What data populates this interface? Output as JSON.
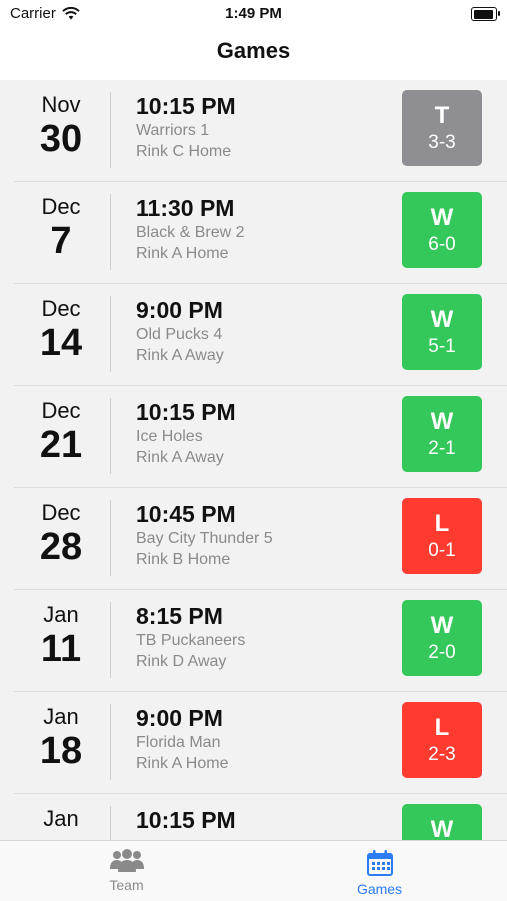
{
  "status": {
    "carrier": "Carrier",
    "time": "1:49 PM"
  },
  "nav": {
    "title": "Games"
  },
  "colors": {
    "tie": "#8e8e93",
    "win": "#34c759",
    "loss": "#ff3b30",
    "accent": "#2b7cf6"
  },
  "games": [
    {
      "month": "Nov",
      "day": "30",
      "time": "10:15 PM",
      "opponent": "Warriors 1",
      "rink": "Rink C Home",
      "result": "T",
      "score": "3-3",
      "status": "tie"
    },
    {
      "month": "Dec",
      "day": "7",
      "time": "11:30 PM",
      "opponent": "Black & Brew 2",
      "rink": "Rink A Home",
      "result": "W",
      "score": "6-0",
      "status": "win"
    },
    {
      "month": "Dec",
      "day": "14",
      "time": "9:00 PM",
      "opponent": "Old Pucks 4",
      "rink": "Rink A Away",
      "result": "W",
      "score": "5-1",
      "status": "win"
    },
    {
      "month": "Dec",
      "day": "21",
      "time": "10:15 PM",
      "opponent": "Ice Holes",
      "rink": "Rink A Away",
      "result": "W",
      "score": "2-1",
      "status": "win"
    },
    {
      "month": "Dec",
      "day": "28",
      "time": "10:45 PM",
      "opponent": "Bay City Thunder 5",
      "rink": "Rink B Home",
      "result": "L",
      "score": "0-1",
      "status": "loss"
    },
    {
      "month": "Jan",
      "day": "11",
      "time": "8:15 PM",
      "opponent": "TB Puckaneers",
      "rink": "Rink D Away",
      "result": "W",
      "score": "2-0",
      "status": "win"
    },
    {
      "month": "Jan",
      "day": "18",
      "time": "9:00 PM",
      "opponent": "Florida Man",
      "rink": "Rink A Home",
      "result": "L",
      "score": "2-3",
      "status": "loss"
    },
    {
      "month": "Jan",
      "day": "",
      "time": "10:15 PM",
      "opponent": "",
      "rink": "",
      "result": "W",
      "score": "",
      "status": "win"
    }
  ],
  "tabs": [
    {
      "label": "Team",
      "icon": "team-icon"
    },
    {
      "label": "Games",
      "icon": "calendar-icon"
    }
  ]
}
